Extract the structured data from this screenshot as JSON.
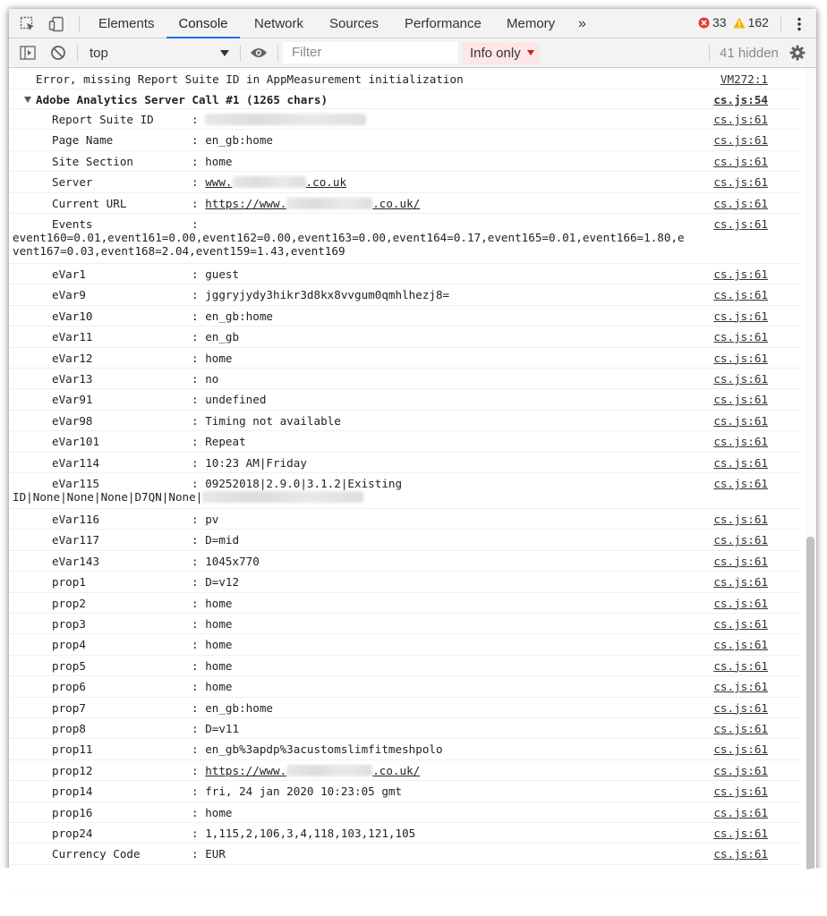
{
  "tabs": [
    "Elements",
    "Console",
    "Network",
    "Sources",
    "Performance",
    "Memory"
  ],
  "more_tabs": "»",
  "errors_count": "33",
  "warnings_count": "162",
  "toolbar": {
    "context": "top",
    "filter_placeholder": "Filter",
    "levels": "Info only",
    "hidden": "41 hidden"
  },
  "console": {
    "error_line": "Error, missing Report Suite ID in AppMeasurement initialization",
    "error_source": "VM272:1",
    "group_title": "Adobe Analytics Server Call #1 (1265 chars)",
    "group_source": "cs.js:54",
    "sep": ":",
    "url_prefix": "https://www.",
    "url_suffix": ".co.uk/",
    "server_prefix": "www.",
    "server_suffix": ".co.uk",
    "events_line1": "event160=0.01,event161=0.00,event162=0.00,event163=0.00,event164=0.17,event165=0.01,event166=1.80,e",
    "events_line2": "vent167=0.03,event168=2.04,event159=1.43,event169",
    "evar115_line1": "09252018|2.9.0|3.1.2|Existing",
    "evar115_line2": "ID|None|None|None|D7QN|None|",
    "rows": [
      {
        "key": "Report Suite ID",
        "value": "",
        "source": "cs.js:61"
      },
      {
        "key": "Page Name",
        "value": "en_gb:home",
        "source": "cs.js:61"
      },
      {
        "key": "Site Section",
        "value": "home",
        "source": "cs.js:61"
      },
      {
        "key": "Server",
        "value": "",
        "source": "cs.js:61"
      },
      {
        "key": "Current URL",
        "value": "",
        "source": "cs.js:61"
      },
      {
        "key": "Events",
        "value": "",
        "source": "cs.js:61"
      },
      {
        "key": "eVar1",
        "value": "guest",
        "source": "cs.js:61"
      },
      {
        "key": "eVar9",
        "value": "jggryjydy3hikr3d8kx8vvgum0qmhlhezj8=",
        "source": "cs.js:61"
      },
      {
        "key": "eVar10",
        "value": "en_gb:home",
        "source": "cs.js:61"
      },
      {
        "key": "eVar11",
        "value": "en_gb",
        "source": "cs.js:61"
      },
      {
        "key": "eVar12",
        "value": "home",
        "source": "cs.js:61"
      },
      {
        "key": "eVar13",
        "value": "no",
        "source": "cs.js:61"
      },
      {
        "key": "eVar91",
        "value": "undefined",
        "source": "cs.js:61"
      },
      {
        "key": "eVar98",
        "value": "Timing not available",
        "source": "cs.js:61"
      },
      {
        "key": "eVar101",
        "value": "Repeat",
        "source": "cs.js:61"
      },
      {
        "key": "eVar114",
        "value": "10:23 AM|Friday",
        "source": "cs.js:61"
      },
      {
        "key": "eVar115",
        "value": "",
        "source": "cs.js:61"
      },
      {
        "key": "eVar116",
        "value": "pv",
        "source": "cs.js:61"
      },
      {
        "key": "eVar117",
        "value": "D=mid",
        "source": "cs.js:61"
      },
      {
        "key": "eVar143",
        "value": "1045x770",
        "source": "cs.js:61"
      },
      {
        "key": "prop1",
        "value": "D=v12",
        "source": "cs.js:61"
      },
      {
        "key": "prop2",
        "value": "home",
        "source": "cs.js:61"
      },
      {
        "key": "prop3",
        "value": "home",
        "source": "cs.js:61"
      },
      {
        "key": "prop4",
        "value": "home",
        "source": "cs.js:61"
      },
      {
        "key": "prop5",
        "value": "home",
        "source": "cs.js:61"
      },
      {
        "key": "prop6",
        "value": "home",
        "source": "cs.js:61"
      },
      {
        "key": "prop7",
        "value": "en_gb:home",
        "source": "cs.js:61"
      },
      {
        "key": "prop8",
        "value": "D=v11",
        "source": "cs.js:61"
      },
      {
        "key": "prop11",
        "value": "en_gb%3apdp%3acustomslimfitmeshpolo",
        "source": "cs.js:61"
      },
      {
        "key": "prop12",
        "value": "",
        "source": "cs.js:61"
      },
      {
        "key": "prop14",
        "value": "fri, 24 jan 2020 10:23:05 gmt",
        "source": "cs.js:61"
      },
      {
        "key": "prop16",
        "value": "home",
        "source": "cs.js:61"
      },
      {
        "key": "prop24",
        "value": "1,115,2,106,3,4,118,103,121,105",
        "source": "cs.js:61"
      },
      {
        "key": "Currency Code",
        "value": "EUR",
        "source": "cs.js:61"
      }
    ]
  }
}
